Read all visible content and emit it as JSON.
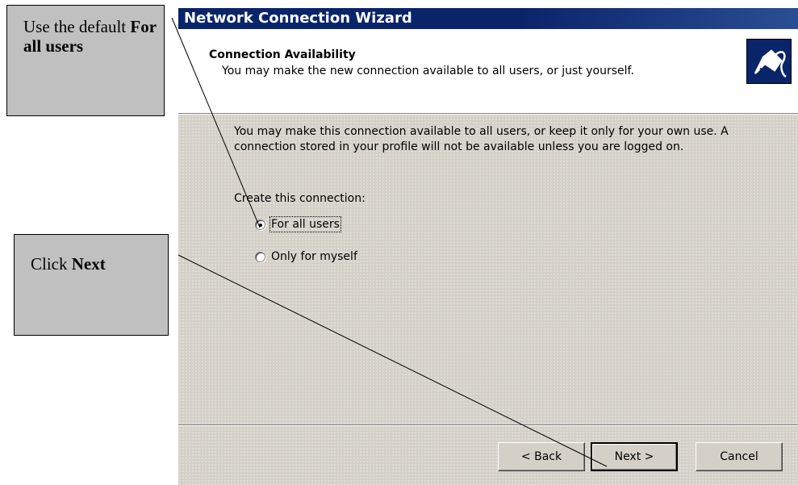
{
  "callouts": {
    "use_default": {
      "prefix": "Use the default ",
      "bold": "For all users"
    },
    "click_next": {
      "prefix": "Click ",
      "bold": "Next"
    }
  },
  "wizard": {
    "title": "Network Connection Wizard",
    "header": {
      "title": "Connection Availability",
      "subtitle": "You may make the new connection available to all users, or just yourself.",
      "icon": "network-cable-icon"
    },
    "intro": "You may make this connection available to all users, or keep it only for your own use.  A connection stored in your profile will not be available unless you are logged on.",
    "create_label": "Create this connection:",
    "options": [
      {
        "label": "For all users",
        "selected": true
      },
      {
        "label": "Only for myself",
        "selected": false
      }
    ],
    "buttons": {
      "back": "< Back",
      "next": "Next >",
      "cancel": "Cancel"
    }
  },
  "colors": {
    "titlebar": "#0a246a",
    "dialog_bg": "#d4d0c8",
    "callout_bg": "#c0c0c0"
  }
}
